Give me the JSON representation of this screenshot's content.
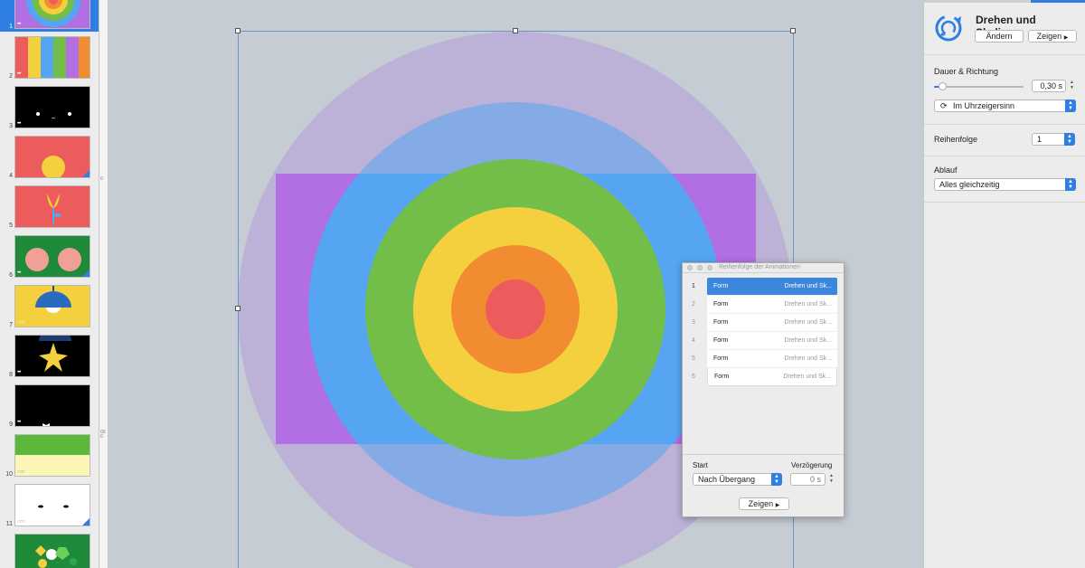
{
  "navigator": {
    "slides": [
      {
        "num": "1",
        "dots": "•••",
        "corner": false,
        "selected": true
      },
      {
        "num": "2",
        "dots": "•••",
        "corner": false,
        "selected": false
      },
      {
        "num": "3",
        "dots": "•••",
        "corner": false,
        "selected": false
      },
      {
        "num": "4",
        "dots": "",
        "corner": true,
        "selected": false
      },
      {
        "num": "5",
        "dots": "",
        "corner": false,
        "selected": false
      },
      {
        "num": "6",
        "dots": "•••",
        "corner": true,
        "selected": false
      },
      {
        "num": "7",
        "dots": "○○○",
        "corner": false,
        "selected": false
      },
      {
        "num": "8",
        "dots": "•••",
        "corner": false,
        "selected": false
      },
      {
        "num": "9",
        "dots": "•••",
        "corner": false,
        "selected": false
      },
      {
        "num": "10",
        "dots": "○○○",
        "corner": false,
        "selected": false
      },
      {
        "num": "11",
        "dots": "○○○",
        "corner": true,
        "selected": false
      },
      {
        "num": "",
        "dots": "",
        "corner": false,
        "selected": false
      }
    ]
  },
  "ruler": {
    "marks": [
      "0",
      "000"
    ]
  },
  "colors": {
    "accent": "#2f7fe3",
    "purple": "#b26ee3",
    "blue": "#55a5f2",
    "green": "#72be48",
    "yellow": "#f4d03f",
    "orange": "#f28c30",
    "red": "#ec5c5c"
  },
  "inspector": {
    "title": "Drehen und Skalieren",
    "change_label": "Ändern",
    "show_label": "Zeigen",
    "duration_label": "Dauer & Richtung",
    "duration_value": "0,30 s",
    "direction_value": "Im Uhrzeigersinn",
    "order_label": "Reihenfolge",
    "order_value": "1",
    "flow_label": "Ablauf",
    "flow_value": "Alles gleichzeitig"
  },
  "anim_panel": {
    "title": "Reihenfolge der Animationen",
    "rows": [
      {
        "idx": "1",
        "name": "Form",
        "effect": "Drehen und Sk..."
      },
      {
        "idx": "2",
        "name": "Form",
        "effect": "Drehen und Sk..."
      },
      {
        "idx": "3",
        "name": "Form",
        "effect": "Drehen und Sk..."
      },
      {
        "idx": "4",
        "name": "Form",
        "effect": "Drehen und Sk..."
      },
      {
        "idx": "5",
        "name": "Form",
        "effect": "Drehen und Sk..."
      },
      {
        "idx": "6",
        "name": "Form",
        "effect": "Drehen und Sk..."
      }
    ],
    "start_label": "Start",
    "start_value": "Nach Übergang",
    "delay_label": "Verzögerung",
    "delay_value": "0 s",
    "show_label": "Zeigen"
  }
}
